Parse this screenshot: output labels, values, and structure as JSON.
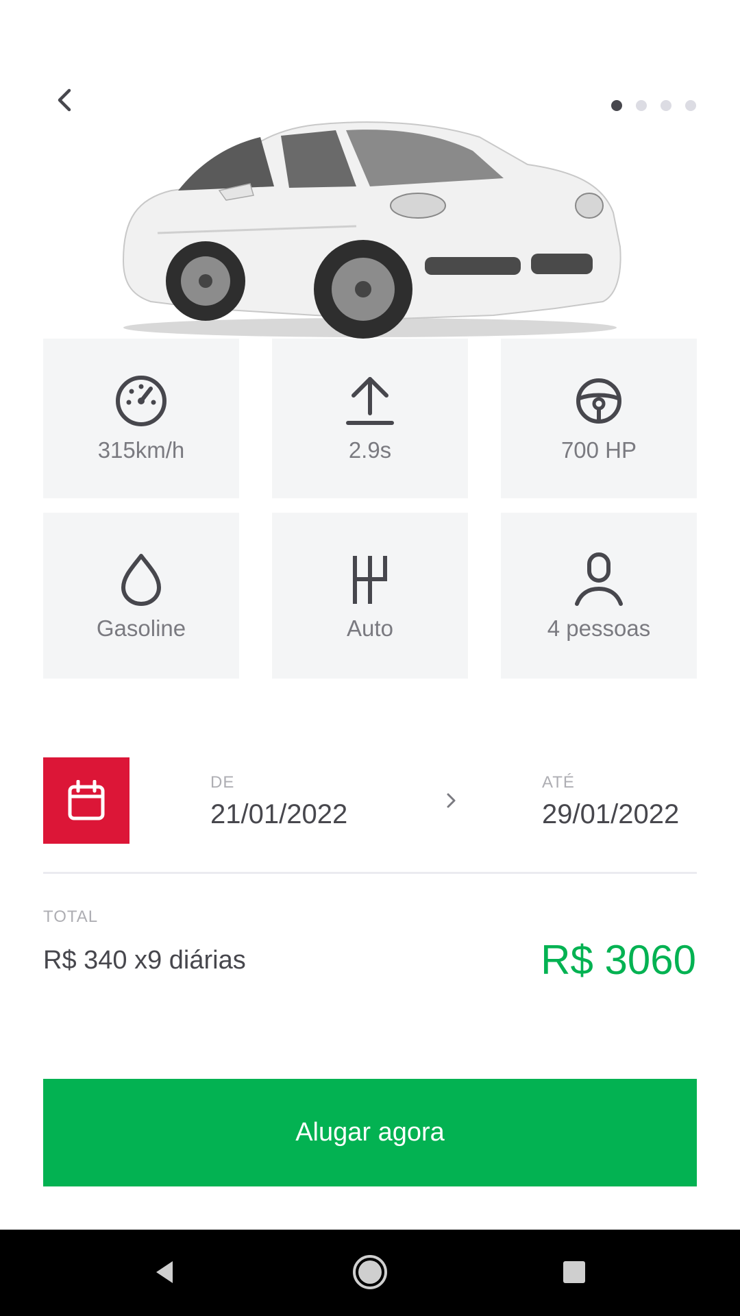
{
  "header": {
    "carousel_dots": [
      true,
      false,
      false,
      false
    ]
  },
  "specs": [
    {
      "icon": "speedometer-icon",
      "label": "315km/h"
    },
    {
      "icon": "acceleration-icon",
      "label": "2.9s"
    },
    {
      "icon": "steering-wheel-icon",
      "label": "700 HP"
    },
    {
      "icon": "fuel-drop-icon",
      "label": "Gasoline"
    },
    {
      "icon": "gear-shift-icon",
      "label": "Auto"
    },
    {
      "icon": "person-icon",
      "label": "4 pessoas"
    }
  ],
  "rental_period": {
    "from_label": "DE",
    "from_value": "21/01/2022",
    "to_label": "ATÉ",
    "to_value": "29/01/2022"
  },
  "total": {
    "label": "TOTAL",
    "description": "R$ 340 x9 diárias",
    "price": "R$ 3060"
  },
  "actions": {
    "rent_label": "Alugar agora"
  },
  "colors": {
    "accent_red": "#dc1637",
    "success_green": "#03b252",
    "text_dark": "#47474d",
    "text_muted": "#7a7a80",
    "card_bg": "#f4f5f6"
  }
}
